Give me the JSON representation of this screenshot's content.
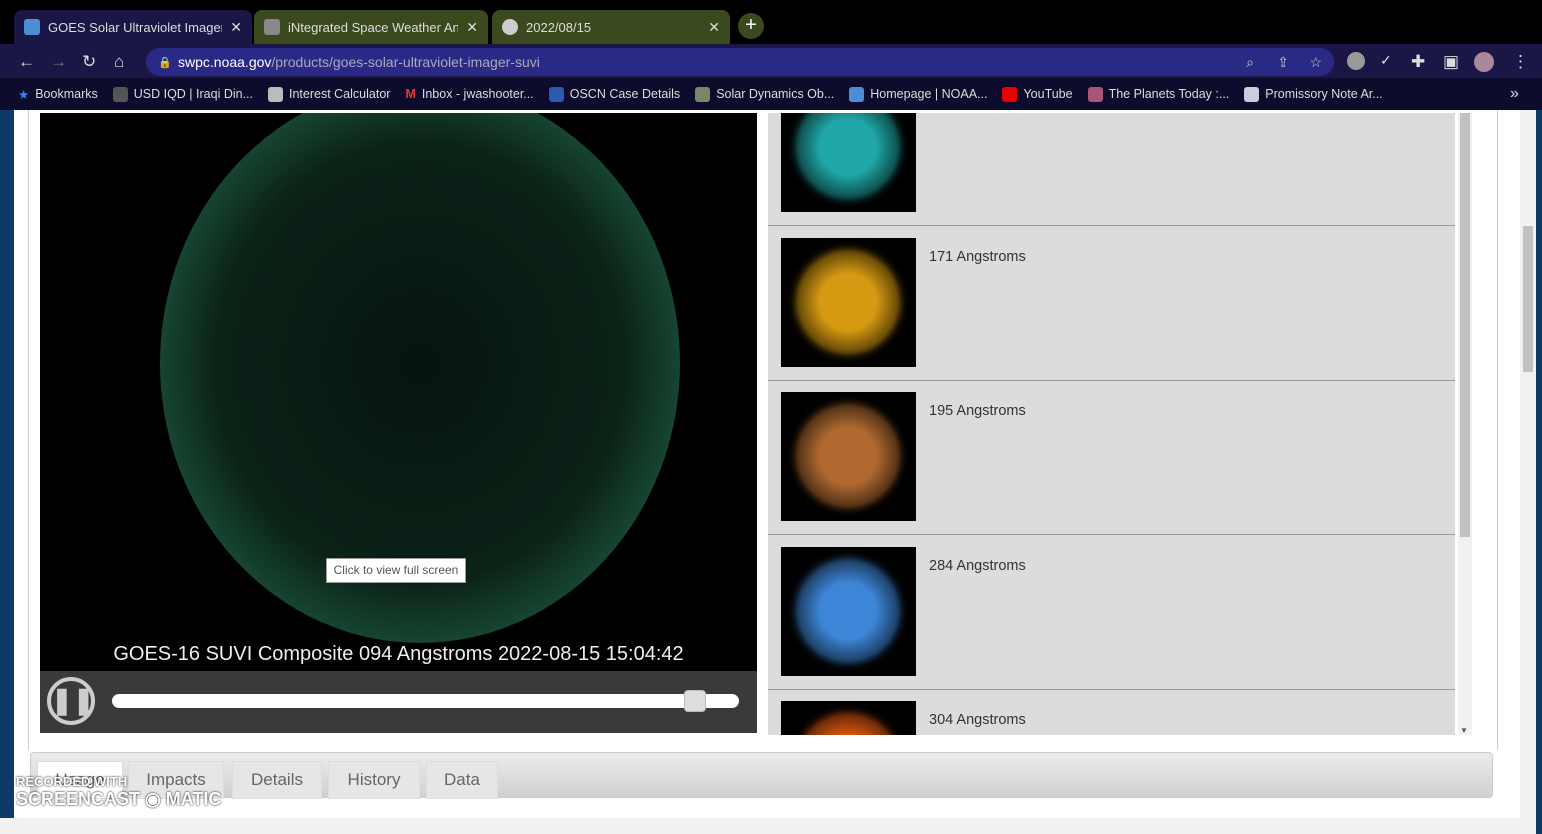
{
  "browser": {
    "tabs": [
      {
        "title": "GOES Solar Ultraviolet Imager (SUVI)",
        "active": true
      },
      {
        "title": "iNtegrated Space Weather Analysis",
        "active": false
      },
      {
        "title": "2022/08/15",
        "active": false
      }
    ],
    "url_host": "swpc.noaa.gov",
    "url_path": "/products/goes-solar-ultraviolet-imager-suvi",
    "bookmarks": [
      "Bookmarks",
      "USD IQD | Iraqi Din...",
      "Interest Calculator",
      "Inbox - jwashooter...",
      "OSCN Case Details",
      "Solar Dynamics Ob...",
      "Homepage | NOAA...",
      "YouTube",
      "The Planets Today :...",
      "Promissory Note Ar..."
    ]
  },
  "viewer": {
    "caption": "GOES-16 SUVI Composite 094 Angstroms 2022-08-15 15:04:42",
    "fullscreen_tip": "Click to view full screen",
    "slider_percent": 93,
    "playing": true
  },
  "channels": [
    {
      "label": "",
      "color": "#1fa6a6"
    },
    {
      "label": "171 Angstroms",
      "color": "#d69a12"
    },
    {
      "label": "195 Angstroms",
      "color": "#b06a30"
    },
    {
      "label": "284 Angstroms",
      "color": "#3d85d6"
    },
    {
      "label": "304 Angstroms",
      "color": "#e05a10"
    }
  ],
  "page_tabs": [
    "Usage",
    "Impacts",
    "Details",
    "History",
    "Data"
  ],
  "watermark": "RECORDED WITH SCREENCAST-O-MATIC"
}
